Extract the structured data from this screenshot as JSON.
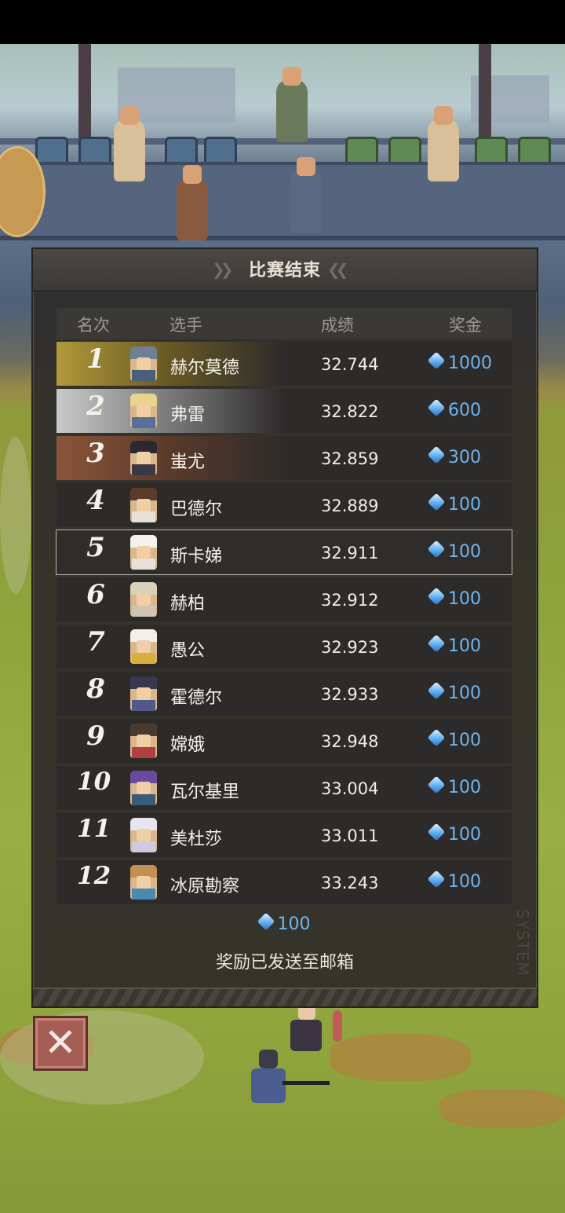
{
  "dialog": {
    "title": "比赛结束",
    "columns": {
      "rank": "名次",
      "player": "选手",
      "score": "成绩",
      "prize": "奖金"
    },
    "rows": [
      {
        "rank": "1",
        "name": "赫尔莫德",
        "score": "32.744",
        "prize": "1000",
        "style": "gold"
      },
      {
        "rank": "2",
        "name": "弗雷",
        "score": "32.822",
        "prize": "600",
        "style": "silver"
      },
      {
        "rank": "3",
        "name": "蚩尤",
        "score": "32.859",
        "prize": "300",
        "style": "bronze"
      },
      {
        "rank": "4",
        "name": "巴德尔",
        "score": "32.889",
        "prize": "100",
        "style": "normal"
      },
      {
        "rank": "5",
        "name": "斯卡娣",
        "score": "32.911",
        "prize": "100",
        "style": "highlight"
      },
      {
        "rank": "6",
        "name": "赫柏",
        "score": "32.912",
        "prize": "100",
        "style": "normal"
      },
      {
        "rank": "7",
        "name": "愚公",
        "score": "32.923",
        "prize": "100",
        "style": "normal"
      },
      {
        "rank": "8",
        "name": "霍德尔",
        "score": "32.933",
        "prize": "100",
        "style": "normal"
      },
      {
        "rank": "9",
        "name": "嫦娥",
        "score": "32.948",
        "prize": "100",
        "style": "normal"
      },
      {
        "rank": "10",
        "name": "瓦尔基里",
        "score": "33.004",
        "prize": "100",
        "style": "normal"
      },
      {
        "rank": "11",
        "name": "美杜莎",
        "score": "33.011",
        "prize": "100",
        "style": "normal"
      },
      {
        "rank": "12",
        "name": "冰原勘察",
        "score": "33.243",
        "prize": "100",
        "style": "normal"
      }
    ],
    "total_reward": "100",
    "reward_note": "奖励已发送至邮箱",
    "watermark": "SYSTEM"
  },
  "close_button": {
    "label": "✕"
  },
  "colors": {
    "gem_blue": "#6fb6f0",
    "gold": "#b09a3a",
    "silver": "#c9c9c9",
    "bronze": "#8a553a",
    "close_red": "#a55e55"
  },
  "icons": [
    "gem-icon",
    "close-icon",
    "player-portrait"
  ]
}
